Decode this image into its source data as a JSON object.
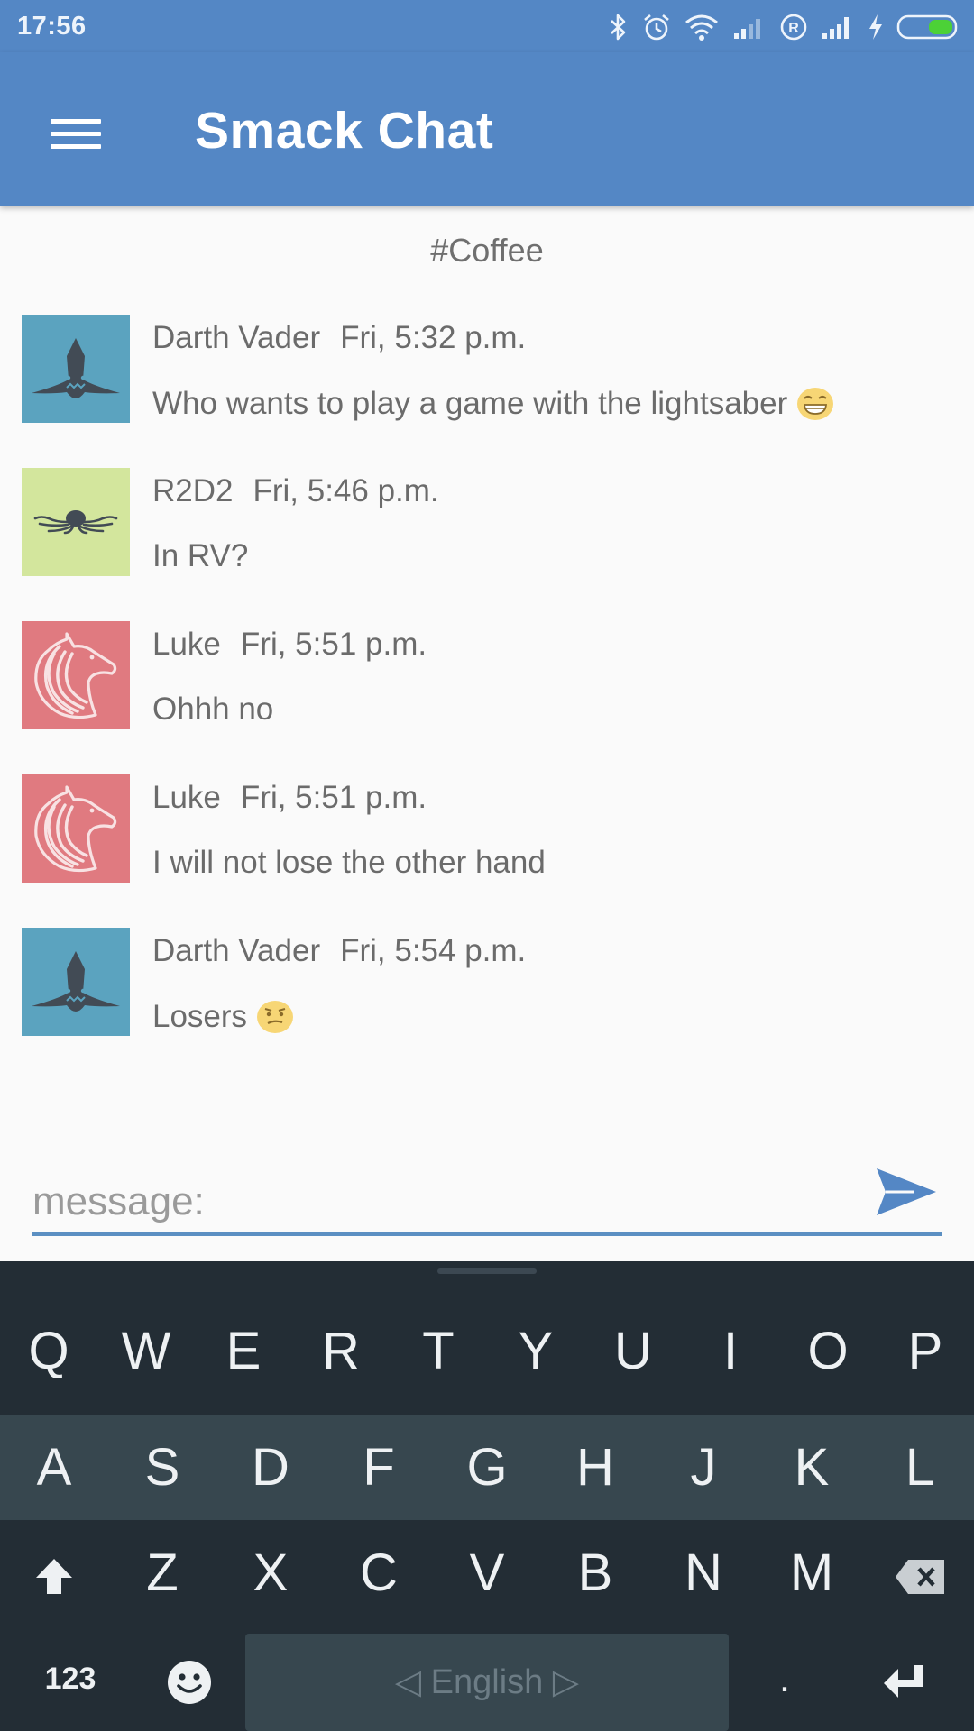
{
  "status_bar": {
    "time": "17:56"
  },
  "app_bar": {
    "title": "Smack Chat"
  },
  "channel": {
    "name": "#Coffee"
  },
  "messages": [
    {
      "user": "Darth Vader",
      "time": "Fri, 5:32 p.m.",
      "text": "Who wants to play a game with the lightsaber",
      "avatar": "shark",
      "avatar_bg": "#5ba3bf",
      "emoji": "grinning-face"
    },
    {
      "user": "R2D2",
      "time": "Fri, 5:46 p.m.",
      "text": "In RV?",
      "avatar": "octopus",
      "avatar_bg": "#d3e69d",
      "emoji": ""
    },
    {
      "user": "Luke",
      "time": "Fri, 5:51 p.m.",
      "text": "Ohhh no",
      "avatar": "horse",
      "avatar_bg": "#e07a80",
      "emoji": ""
    },
    {
      "user": "Luke",
      "time": "Fri, 5:51 p.m.",
      "text": "I will not lose the other hand",
      "avatar": "horse",
      "avatar_bg": "#e07a80",
      "emoji": ""
    },
    {
      "user": "Darth Vader",
      "time": "Fri, 5:54 p.m.",
      "text": "Losers",
      "avatar": "shark",
      "avatar_bg": "#5ba3bf",
      "emoji": "confused-face"
    }
  ],
  "composer": {
    "placeholder": "message:",
    "value": "",
    "send_icon": "send-icon"
  },
  "keyboard": {
    "row1": [
      "Q",
      "W",
      "E",
      "R",
      "T",
      "Y",
      "U",
      "I",
      "O",
      "P"
    ],
    "row2": [
      "A",
      "S",
      "D",
      "F",
      "G",
      "H",
      "J",
      "K",
      "L"
    ],
    "row3": [
      "Z",
      "X",
      "C",
      "V",
      "B",
      "N",
      "M"
    ],
    "numbers_key": "123",
    "space_label": "◁ English ▷",
    "period_key": "."
  },
  "colors": {
    "primary": "#5487c5",
    "keyboard_bg": "#232d35",
    "keyboard_row_alt": "#37474f",
    "text": "#6b6b6b"
  }
}
